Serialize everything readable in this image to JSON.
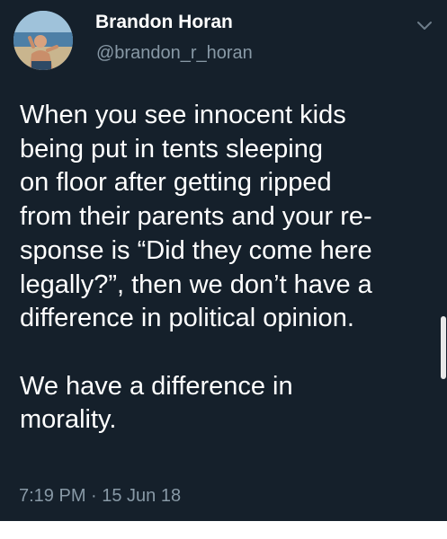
{
  "tweet": {
    "display_name": "Brandon Horan",
    "handle": "@brandon_r_horan",
    "lines_paragraph_1": [
      "When you see innocent kids",
      "being put in tents sleeping",
      "on floor after getting ripped",
      "from their parents and your re-",
      "sponse is “Did they come here",
      "legally?”, then we don’t have a",
      "difference in political opinion."
    ],
    "lines_paragraph_2": [
      "We have a difference in",
      "morality."
    ],
    "timestamp": "7:19 PM · 15 Jun 18"
  },
  "icons": {
    "avatar": "avatar-photo",
    "menu": "chevron-down-icon"
  },
  "colors": {
    "background": "#15202b",
    "primary_text": "#ffffff",
    "secondary_text": "#8899a6"
  }
}
